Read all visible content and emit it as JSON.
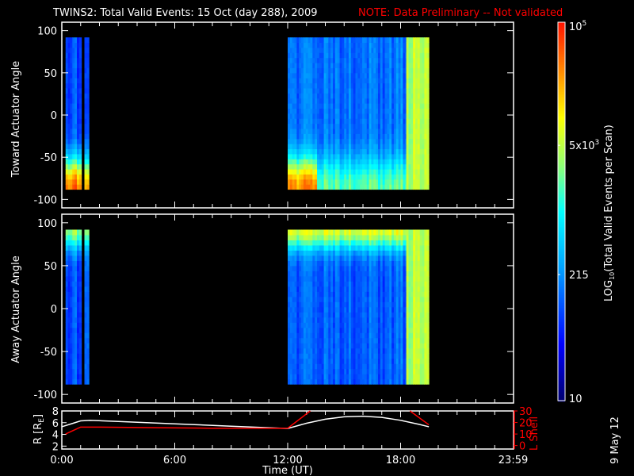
{
  "title": "TWINS2: Total Valid Events: 15 Oct (day 288), 2009",
  "note": "NOTE: Data Preliminary -- Not validated",
  "side_label": "9 May 12",
  "colors": {
    "note": "#ff0000",
    "lshell": "#ff0000",
    "radius": "#ffffff"
  },
  "chart_data": [
    {
      "type": "heatmap",
      "ylabel": "Toward Actuator Angle",
      "yticks": [
        "100",
        "50",
        "0",
        "-50",
        "-100"
      ],
      "ylim": [
        -110,
        110
      ],
      "xlim_hours": [
        0,
        24
      ],
      "segments": [
        {
          "start": 0.2,
          "end": 1.0,
          "base": 1.9,
          "edge": "bottom",
          "edge_boost": 2.6
        },
        {
          "start": 1.2,
          "end": 1.4,
          "base": 1.7,
          "edge": "bottom",
          "edge_boost": 2.4
        },
        {
          "start": 12.0,
          "end": 18.3,
          "base": 2.1,
          "edge": "bottom",
          "edge_boost": 2.3
        },
        {
          "start": 18.3,
          "end": 19.5,
          "base": 3.6,
          "edge": "none",
          "edge_boost": 0
        }
      ],
      "angle_range": [
        -88,
        90
      ]
    },
    {
      "type": "heatmap",
      "ylabel": "Away Actuator Angle",
      "yticks": [
        "100",
        "50",
        "0",
        "-50",
        "-100"
      ],
      "ylim": [
        -110,
        110
      ],
      "xlim_hours": [
        0,
        24
      ],
      "segments": [
        {
          "start": 0.2,
          "end": 1.0,
          "base": 1.9,
          "edge": "top",
          "edge_boost": 1.6
        },
        {
          "start": 1.2,
          "end": 1.4,
          "base": 1.9,
          "edge": "top",
          "edge_boost": 1.4
        },
        {
          "start": 12.0,
          "end": 18.3,
          "base": 2.0,
          "edge": "top",
          "edge_boost": 1.8
        },
        {
          "start": 18.3,
          "end": 19.5,
          "base": 3.6,
          "edge": "none",
          "edge_boost": 0
        }
      ],
      "angle_range": [
        -88,
        90
      ]
    },
    {
      "type": "line",
      "ylabel": "R [R",
      "ylabel_sub": "E",
      "ylabel_end": "]",
      "y2label": "L Shell",
      "yticks": [
        "8",
        "6",
        "4",
        "2"
      ],
      "ylim": [
        1.5,
        8
      ],
      "y2ticks": [
        "30",
        "20",
        "10",
        "0"
      ],
      "y2lim": [
        -3,
        30
      ],
      "xlabel": "Time (UT)",
      "xticks": [
        "0:00",
        "6:00",
        "12:00",
        "18:00",
        "23:59"
      ],
      "series": [
        {
          "name": "R",
          "axis": "left",
          "x": [
            0,
            0.5,
            1,
            1.5,
            3,
            6,
            9,
            12,
            13,
            14,
            15,
            16,
            17,
            18,
            19,
            19.5
          ],
          "y": [
            5.3,
            5.8,
            6.3,
            6.4,
            6.2,
            5.8,
            5.4,
            5.0,
            5.9,
            6.6,
            7.0,
            7.1,
            6.9,
            6.4,
            5.7,
            5.3
          ]
        },
        {
          "name": "L Shell",
          "axis": "right",
          "x": [
            0.2,
            0.6,
            1,
            2,
            5,
            8,
            12,
            13.2
          ],
          "y": [
            10,
            13,
            16,
            16,
            15.5,
            15,
            15,
            30
          ]
        },
        {
          "name": "L Shell 2",
          "axis": "right",
          "x": [
            18.5,
            19.5
          ],
          "y": [
            30,
            18
          ]
        }
      ]
    }
  ],
  "colorbar": {
    "label": "LOG",
    "label_sub": "10",
    "label_rest": "(Total Valid Events per Scan)",
    "range": [
      10,
      100000
    ],
    "ticks": [
      {
        "value": 100000,
        "label": "10",
        "sup": "5"
      },
      {
        "value": 5000,
        "label": "5x10",
        "sup": "3"
      },
      {
        "value": 215,
        "label": "215",
        "sup": ""
      },
      {
        "value": 10,
        "label": "10",
        "sup": ""
      }
    ]
  }
}
